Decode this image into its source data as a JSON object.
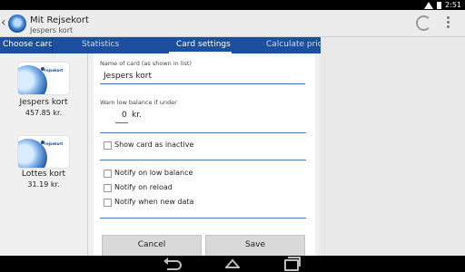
{
  "status_bar": {
    "time": "2:51"
  },
  "header": {
    "app_title": "Mit Rejsekort",
    "subtitle": "Jespers kort",
    "back_symbol": "‹"
  },
  "tabs": [
    {
      "label": "Choose card"
    },
    {
      "label": "Statistics"
    },
    {
      "label": "Card settings",
      "selected": true
    },
    {
      "label": "Calculate price"
    }
  ],
  "cards": [
    {
      "name": "Jespers kort",
      "balance": "457.85 kr.",
      "brand": "rejsekort"
    },
    {
      "name": "Lottes kort",
      "balance": "31.19 kr.",
      "brand": "rejsekort"
    }
  ],
  "form": {
    "name_label": "Name of card (as shown in list)",
    "name_value": "Jespers kort",
    "warn_label": "Warn low balance if under",
    "warn_value": "0",
    "warn_unit": "kr.",
    "show_inactive_label": "Show card as inactive",
    "notify_low_label": "Notify on low balance",
    "notify_reload_label": "Notify on reload",
    "notify_new_data_label": "Notify when new data"
  },
  "buttons": {
    "cancel": "Cancel",
    "save": "Save"
  },
  "icons": {
    "refresh": "refresh-icon",
    "overflow": "overflow-menu-icon",
    "back": "nav-back-icon",
    "home": "nav-home-icon",
    "recent": "nav-recent-apps-icon"
  },
  "colors": {
    "tab_bar": "#1d4f9f",
    "accent_line": "#3a6fbf"
  }
}
